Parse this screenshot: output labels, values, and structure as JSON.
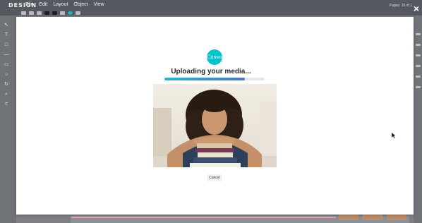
{
  "app": {
    "brand": "DESIGN",
    "menu": [
      "File",
      "Edit",
      "Layout",
      "Object",
      "View"
    ],
    "pages_label": "Pages: 10 of 1"
  },
  "upload_dialog": {
    "logo_text": "Canva",
    "status": "Uploading your media...",
    "progress_fraction": 0.8,
    "cancel_label": "Cancel",
    "image_description_icon": "uploaded-photo"
  },
  "colors": {
    "brand_teal": "#00c4cc",
    "progress_start": "#2bb3d1",
    "progress_end": "#4a78c6",
    "modal_bg": "#ffffff",
    "backdrop": "#7d7f84"
  }
}
